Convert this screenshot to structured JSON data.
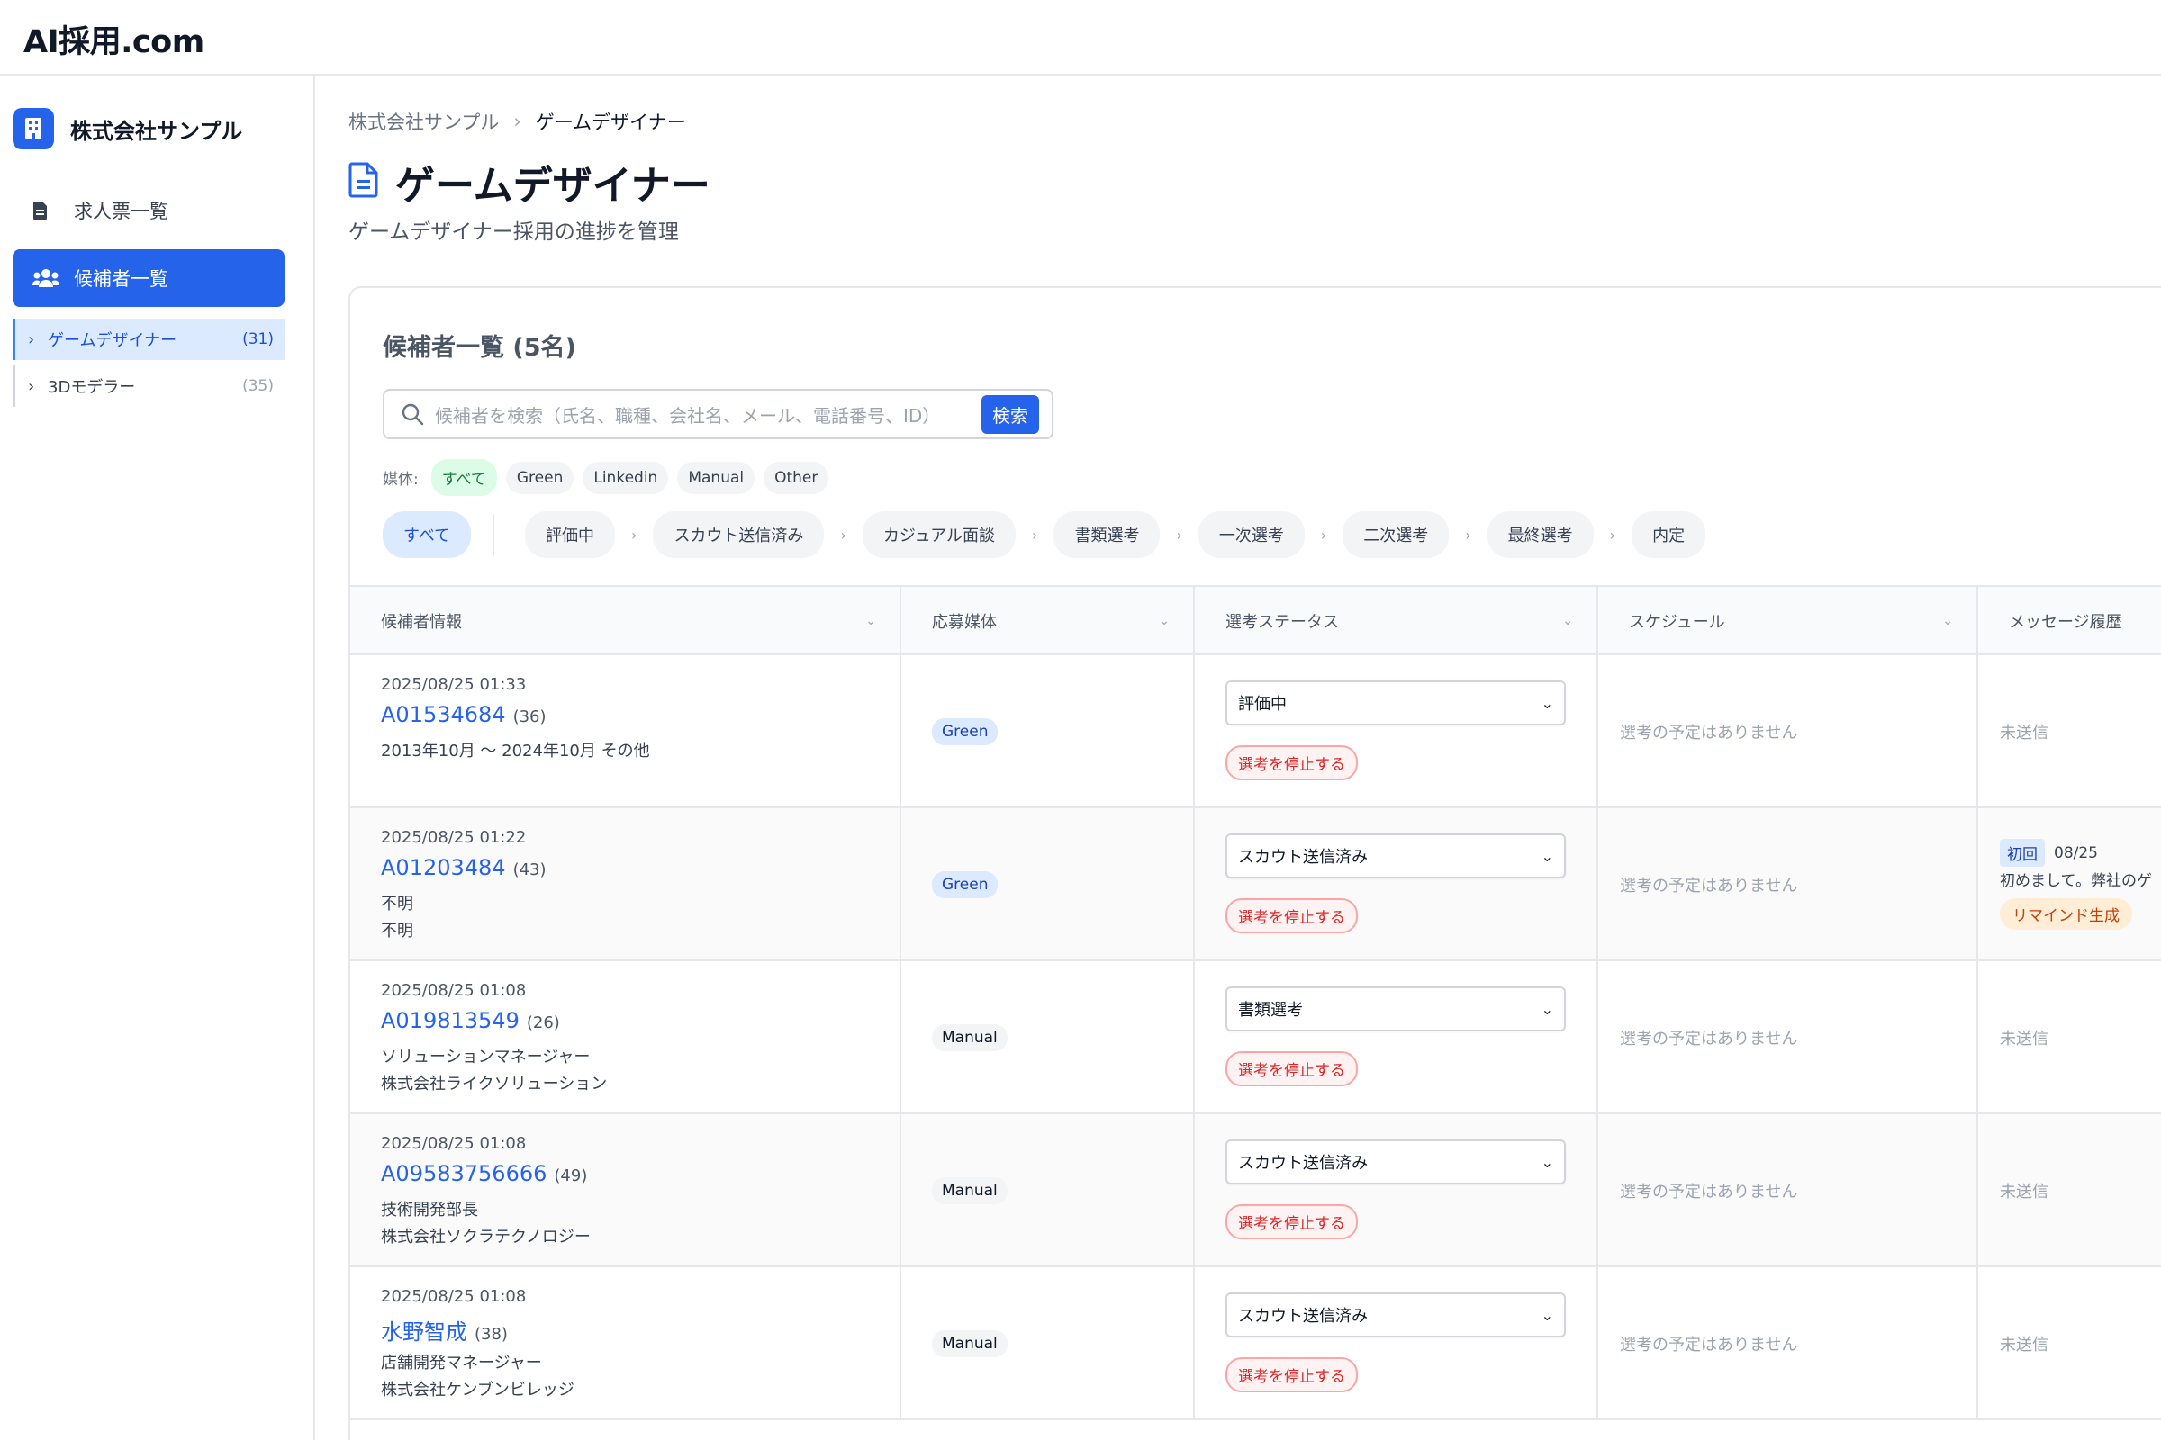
{
  "app": {
    "title": "AI採用.com"
  },
  "sidebar": {
    "company": "株式会社サンプル",
    "nav": [
      {
        "label": "求人票一覧",
        "icon": "document-icon"
      },
      {
        "label": "候補者一覧",
        "icon": "users-icon",
        "active": true
      }
    ],
    "sub_items": [
      {
        "label": "ゲームデザイナー",
        "count": "(31)",
        "active": true
      },
      {
        "label": "3Dモデラー",
        "count": "(35)"
      }
    ]
  },
  "breadcrumb": {
    "root": "株式会社サンプル",
    "separator": "›",
    "current": "ゲームデザイナー"
  },
  "page": {
    "title": "ゲームデザイナー",
    "subtitle": "ゲームデザイナー採用の進捗を管理"
  },
  "list": {
    "title": "候補者一覧 (5名)",
    "search": {
      "placeholder": "候補者を検索（氏名、職種、会社名、メール、電話番号、ID）",
      "button": "検索"
    },
    "media_filter": {
      "label": "媒体:",
      "options": [
        "すべて",
        "Green",
        "Linkedin",
        "Manual",
        "Other"
      ],
      "selected": "すべて"
    },
    "status_filter": {
      "all": "すべて",
      "stages": [
        "評価中",
        "スカウト送信済み",
        "カジュアル面談",
        "書類選考",
        "一次選考",
        "二次選考",
        "最終選考",
        "内定"
      ]
    },
    "columns": [
      "候補者情報",
      "応募媒体",
      "選考ステータス",
      "スケジュール",
      "メッセージ履歴"
    ],
    "stop_label": "選考を停止する",
    "no_schedule": "選考の予定はありません",
    "not_sent": "未送信",
    "rows": [
      {
        "date": "2025/08/25 01:33",
        "id": "A01534684",
        "age": "(36)",
        "line1": "2013年10月 〜 2024年10月 その他",
        "line2": "",
        "media": "Green",
        "status": "評価中",
        "message": "未送信"
      },
      {
        "date": "2025/08/25 01:22",
        "id": "A01203484",
        "age": "(43)",
        "line1": "不明",
        "line2": "不明",
        "media": "Green",
        "status": "スカウト送信済み",
        "message_detail": {
          "tag": "初回",
          "date": "08/25",
          "preview": "初めまして。弊社のゲ",
          "action": "リマインド生成"
        }
      },
      {
        "date": "2025/08/25 01:08",
        "id": "A019813549",
        "age": "(26)",
        "line1": "ソリューションマネージャー",
        "line2": "株式会社ライクソリューション",
        "media": "Manual",
        "status": "書類選考",
        "message": "未送信"
      },
      {
        "date": "2025/08/25 01:08",
        "id": "A09583756666",
        "age": "(49)",
        "line1": "技術開発部長",
        "line2": "株式会社ソクラテクノロジー",
        "media": "Manual",
        "status": "スカウト送信済み",
        "message": "未送信"
      },
      {
        "date": "2025/08/25 01:08",
        "id": "水野智成",
        "age": "(38)",
        "line1": "店舗開発マネージャー",
        "line2": "株式会社ケンブンビレッジ",
        "media": "Manual",
        "status": "スカウト送信済み",
        "message": "未送信"
      }
    ]
  },
  "colors": {
    "accent": "#2563eb",
    "danger": "#dc2626",
    "warning": "#c2410c",
    "success": "#15803d"
  }
}
